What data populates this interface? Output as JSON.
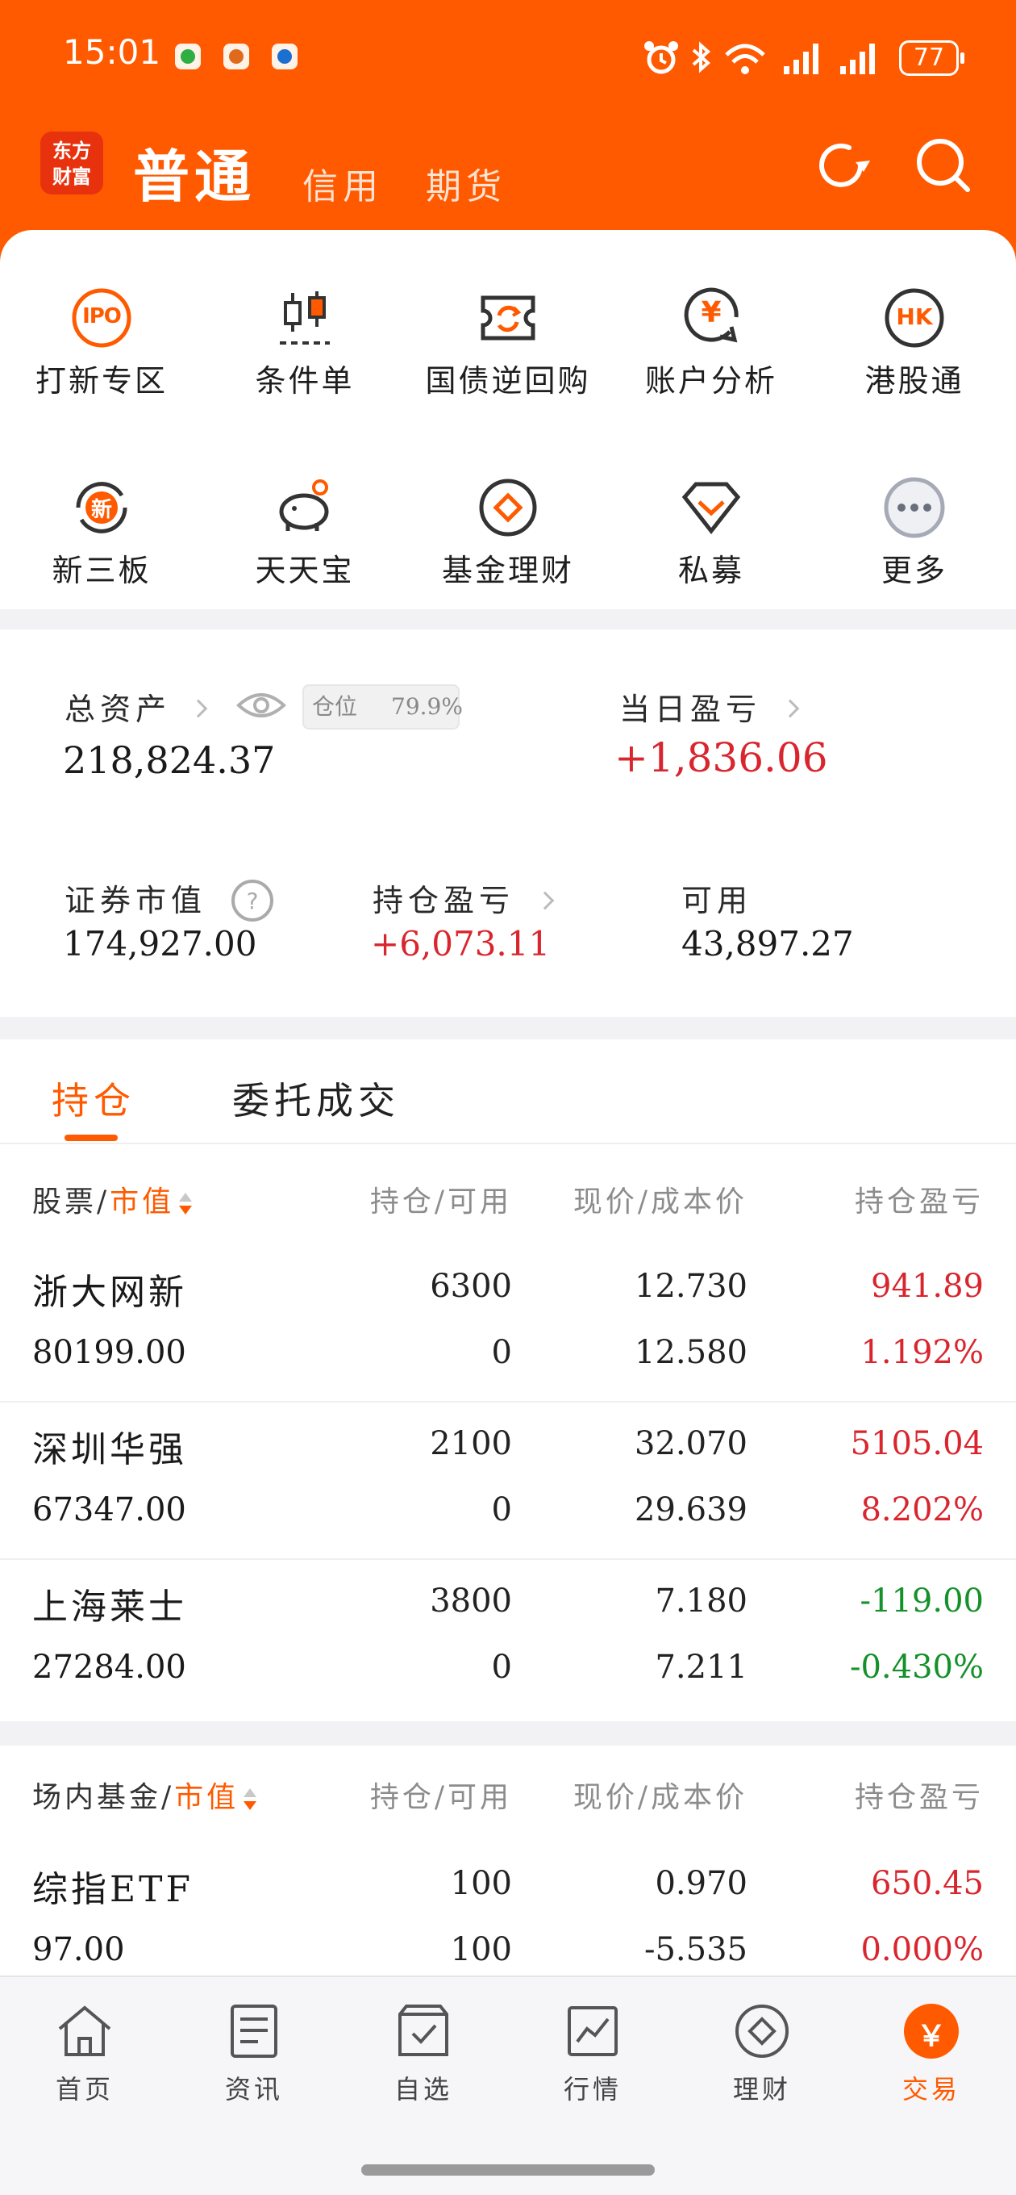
{
  "status_bar": {
    "time": "15:01",
    "battery": "77",
    "app_icons": [
      "wechat-icon",
      "app-icon",
      "app-icon"
    ],
    "right_icons": [
      "alarm-icon",
      "bluetooth-icon",
      "wifi-icon",
      "signal-icon",
      "signal-icon"
    ]
  },
  "header": {
    "logo_line1": "东方",
    "logo_line2": "财富",
    "tab_active": "普通",
    "tab_credit": "信用",
    "tab_futures": "期货",
    "accent": "#ff5a00"
  },
  "quick_menu": [
    {
      "label": "打新专区",
      "icon": "ipo-icon",
      "icon_text": "IPO"
    },
    {
      "label": "条件单",
      "icon": "candlestick-icon"
    },
    {
      "label": "国债逆回购",
      "icon": "repo-icon"
    },
    {
      "label": "账户分析",
      "icon": "yuan-analysis-icon",
      "icon_text": "¥"
    },
    {
      "label": "港股通",
      "icon": "hk-icon",
      "icon_text": "HK"
    },
    {
      "label": "新三板",
      "icon": "new-board-icon",
      "icon_text": "新"
    },
    {
      "label": "天天宝",
      "icon": "piggy-bank-icon"
    },
    {
      "label": "基金理财",
      "icon": "fund-icon"
    },
    {
      "label": "私募",
      "icon": "private-fund-icon"
    },
    {
      "label": "更多",
      "icon": "more-icon"
    }
  ],
  "assets": {
    "total_label": "总资产",
    "total_value": "218,824.37",
    "position_label": "仓位",
    "position_value": "79.9%",
    "position_ratio": 0.799,
    "daily_pl_label": "当日盈亏",
    "daily_pl_value": "+1,836.06",
    "securities_label": "证券市值",
    "securities_value": "174,927.00",
    "holding_pl_label": "持仓盈亏",
    "holding_pl_value": "+6,073.11",
    "available_label": "可用",
    "available_value": "43,897.27"
  },
  "holdings_tabs": {
    "active": "持仓",
    "other": "委托成交"
  },
  "stocks": {
    "header": {
      "col1_prefix": "股票/",
      "col1_sort": "市值",
      "col2": "持仓/可用",
      "col3": "现价/成本价",
      "col4": "持仓盈亏"
    },
    "rows": [
      {
        "name": "浙大网新",
        "market_value": "80199.00",
        "hold": "6300",
        "avail": "0",
        "price": "12.730",
        "cost": "12.580",
        "pl": "941.89",
        "pl_pct": "1.192%",
        "dir": "up"
      },
      {
        "name": "深圳华强",
        "market_value": "67347.00",
        "hold": "2100",
        "avail": "0",
        "price": "32.070",
        "cost": "29.639",
        "pl": "5105.04",
        "pl_pct": "8.202%",
        "dir": "up"
      },
      {
        "name": "上海莱士",
        "market_value": "27284.00",
        "hold": "3800",
        "avail": "0",
        "price": "7.180",
        "cost": "7.211",
        "pl": "-119.00",
        "pl_pct": "-0.430%",
        "dir": "down"
      }
    ]
  },
  "funds": {
    "header": {
      "col1_prefix": "场内基金/",
      "col1_sort": "市值",
      "col2": "持仓/可用",
      "col3": "现价/成本价",
      "col4": "持仓盈亏"
    },
    "rows": [
      {
        "name": "综指ETF",
        "market_value": "97.00",
        "hold": "100",
        "avail": "100",
        "price": "0.970",
        "cost": "-5.535",
        "pl": "650.45",
        "pl_pct": "0.000%",
        "dir": "up"
      }
    ]
  },
  "bottom_nav": [
    {
      "label": "首页",
      "icon": "home-icon"
    },
    {
      "label": "资讯",
      "icon": "news-icon"
    },
    {
      "label": "自选",
      "icon": "watchlist-icon"
    },
    {
      "label": "行情",
      "icon": "market-chart-icon"
    },
    {
      "label": "理财",
      "icon": "wealth-icon"
    },
    {
      "label": "交易",
      "icon": "trade-yuan-icon",
      "icon_text": "￥"
    }
  ],
  "colors": {
    "up": "#d9252e",
    "down": "#14912a",
    "accent": "#ff5a00"
  }
}
